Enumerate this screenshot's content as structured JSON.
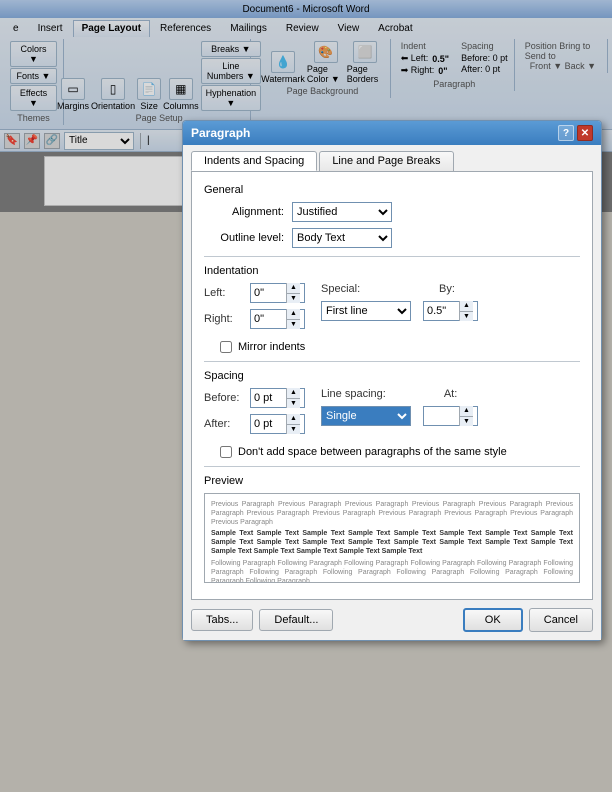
{
  "titlebar": {
    "text": "Document6 - Microsoft Word"
  },
  "ribbon": {
    "tabs": [
      {
        "label": "e",
        "active": false
      },
      {
        "label": "Insert",
        "active": false
      },
      {
        "label": "Page Layout",
        "active": true
      },
      {
        "label": "References",
        "active": false
      },
      {
        "label": "Mailings",
        "active": false
      },
      {
        "label": "Review",
        "active": false
      },
      {
        "label": "View",
        "active": false
      },
      {
        "label": "Acrobat",
        "active": false
      }
    ],
    "groups": {
      "themes": {
        "label": "Themes",
        "buttons": [
          "Colors ▼",
          "Fonts ▼",
          "Effects ▼"
        ]
      },
      "pageSetup": {
        "label": "Page Setup",
        "buttons": [
          "Margins",
          "Orientation",
          "Size",
          "Columns"
        ],
        "dropdowns": [
          "Breaks ▼",
          "Line Numbers ▼",
          "Hyphenation ▼"
        ]
      },
      "pageBackground": {
        "label": "Page Background",
        "buttons": [
          "Watermark",
          "Page Color ▼",
          "Page Borders"
        ]
      },
      "paragraph": {
        "label": "Paragraph",
        "indent_left": "0.5\"",
        "indent_right": "0\"",
        "before": "0 pt",
        "after": "0 pt"
      }
    }
  },
  "toolbar": {
    "style_label": "Title"
  },
  "dialog": {
    "title": "Paragraph",
    "tabs": [
      {
        "label": "Indents and Spacing",
        "active": true
      },
      {
        "label": "Line and Page Breaks",
        "active": false
      }
    ],
    "general": {
      "heading": "General",
      "alignment_label": "Alignment:",
      "alignment_value": "Justified",
      "outline_label": "Outline level:",
      "outline_value": "Body Text"
    },
    "indentation": {
      "heading": "Indentation",
      "left_label": "Left:",
      "left_value": "0\"",
      "right_label": "Right:",
      "right_value": "0\"",
      "special_label": "Special:",
      "special_value": "First line",
      "by_label": "By:",
      "by_value": "0.5\"",
      "mirror_label": "Mirror indents"
    },
    "spacing": {
      "heading": "Spacing",
      "before_label": "Before:",
      "before_value": "0 pt",
      "after_label": "After:",
      "after_value": "0 pt",
      "line_spacing_label": "Line spacing:",
      "line_spacing_value": "Single",
      "at_label": "At:",
      "at_value": "",
      "dont_add_label": "Don't add space between paragraphs of the same style"
    },
    "preview": {
      "heading": "Preview",
      "gray_text_top": "Previous Paragraph Previous Paragraph Previous Paragraph Previous Paragraph Previous Paragraph Previous Paragraph Previous Paragraph Previous Paragraph Previous Paragraph Previous Paragraph Previous Paragraph Previous Paragraph Previous Paragraph",
      "sample_text": "Sample Text Sample Text Sample Text Sample Text Sample Text Sample Text Sample Text Sample Text Sample Text Sample Text Sample Text Sample Text Sample Text Sample Text Sample Text Sample Text Sample Text Sample Text Sample Text Sample Text Sample Text Sample Text Sample Text",
      "gray_text_bottom": "Following Paragraph Following Paragraph Following Paragraph Following Paragraph Following Paragraph Following Paragraph Following Paragraph Following Paragraph Following Paragraph Following Paragraph Following Paragraph Following Paragraph"
    },
    "buttons": {
      "tabs": "Tabs...",
      "default": "Default...",
      "ok": "OK",
      "cancel": "Cancel"
    }
  }
}
